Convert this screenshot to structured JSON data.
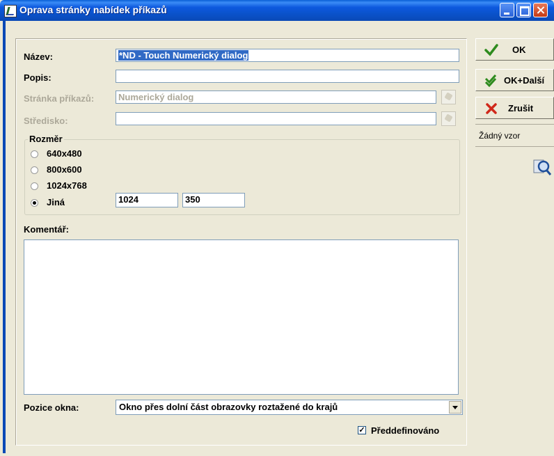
{
  "window": {
    "title": "Oprava stránky nabídek příkazů"
  },
  "form": {
    "name_label": "Název:",
    "name_value": "*ND - Touch Numerický dialog",
    "desc_label": "Popis:",
    "desc_value": "",
    "page_label": "Stránka příkazů:",
    "page_value": "Numerický dialog",
    "center_label": "Středisko:",
    "center_value": ""
  },
  "size_group": {
    "title": "Rozměr",
    "options": [
      {
        "label": "640x480",
        "selected": false
      },
      {
        "label": "800x600",
        "selected": false
      },
      {
        "label": "1024x768",
        "selected": false
      },
      {
        "label": "Jiná",
        "selected": true
      }
    ],
    "custom_width": "1024",
    "custom_height": "350"
  },
  "comment": {
    "label": "Komentář:",
    "value": ""
  },
  "position": {
    "label": "Pozice okna:",
    "value": "Okno přes dolní část obrazovky roztažené do krajů"
  },
  "predefined": {
    "label": "Předdefinováno",
    "checked": true
  },
  "sidebar": {
    "ok_label": "OK",
    "ok_next_label": "OK+Další",
    "cancel_label": "Zrušit",
    "pattern_label": "Žádný vzor"
  },
  "colors": {
    "title_bar": "#0a51c8",
    "selection": "#316ac5",
    "ok_check": "#2e8b1e",
    "cancel_x": "#d0281a"
  }
}
